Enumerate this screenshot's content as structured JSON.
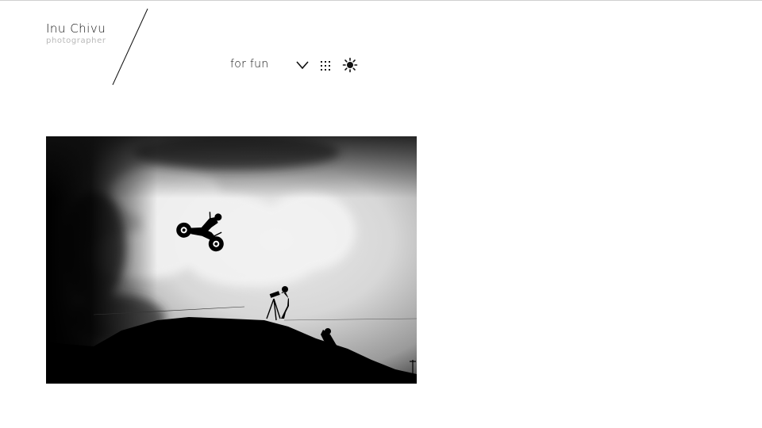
{
  "site": {
    "name": "Inu Chivu",
    "tagline": "photographer"
  },
  "gallery": {
    "title": "for fun"
  },
  "icons": {
    "menu_toggle": "chevron-down-icon",
    "grid_view": "dots-grid-icon",
    "theme_toggle": "sun-icon"
  },
  "photo": {
    "subject": "motocross-jump",
    "tone": "black-and-white"
  },
  "colors": {
    "text": "#111111",
    "tagline": "#b8b8b8",
    "rule": "#d0d0d0",
    "background": "#ffffff"
  }
}
